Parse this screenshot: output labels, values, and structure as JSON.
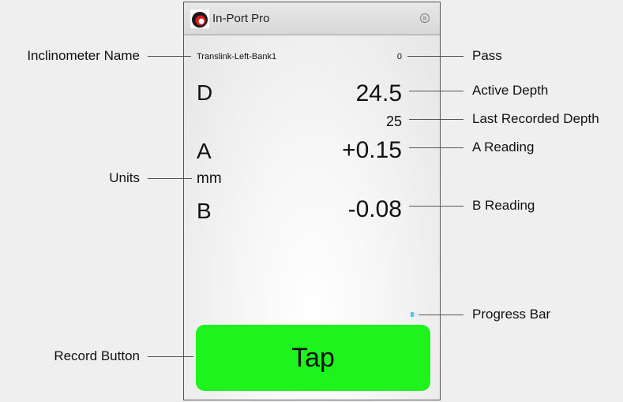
{
  "app": {
    "title": "In-Port Pro"
  },
  "reading": {
    "inclinometer_name": "Translink-Left-Bank1",
    "pass": "0",
    "depth_letter": "D",
    "active_depth": "24.5",
    "last_recorded_depth": "25",
    "a_letter": "A",
    "a_reading": "+0.15",
    "units": "mm",
    "b_letter": "B",
    "b_reading": "-0.08"
  },
  "progress": {
    "fraction": 0.5,
    "color": "#4fc3f7"
  },
  "record_button": {
    "label": "Tap",
    "color": "#1ef31e"
  },
  "annotations": {
    "inclinometer_name": "Inclinometer Name",
    "units": "Units",
    "record_button": "Record Button",
    "pass": "Pass",
    "active_depth": "Active Depth",
    "last_recorded_depth": "Last Recorded Depth",
    "a_reading": "A Reading",
    "b_reading": "B Reading",
    "progress_bar": "Progress Bar"
  }
}
